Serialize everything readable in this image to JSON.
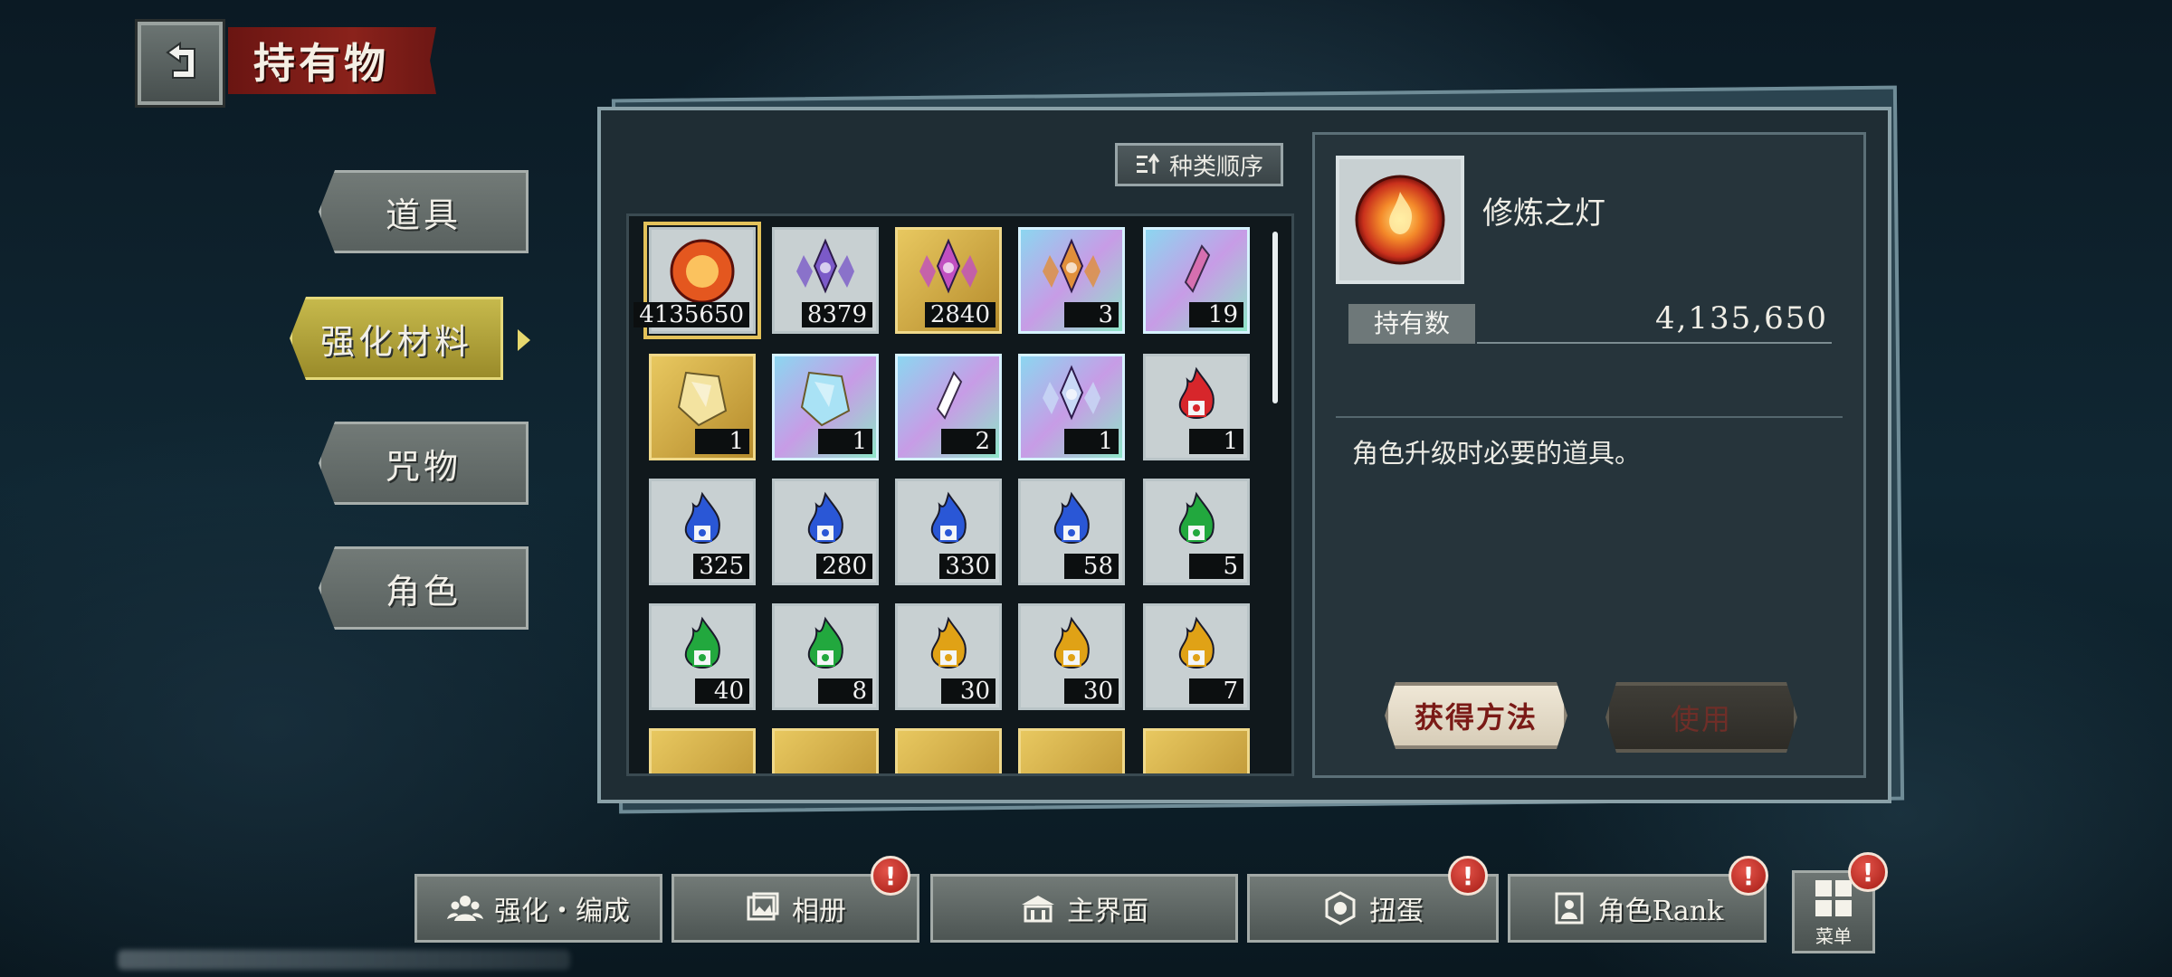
{
  "header": {
    "title": "持有物"
  },
  "tabs": [
    {
      "label": "道具",
      "active": false
    },
    {
      "label": "强化材料",
      "active": true
    },
    {
      "label": "咒物",
      "active": false
    },
    {
      "label": "角色",
      "active": false
    }
  ],
  "sort": {
    "label": "种类顺序"
  },
  "items": [
    {
      "count": "4135650",
      "style": "orb",
      "frame": "silver",
      "color": "#e4571f",
      "selected": true
    },
    {
      "count": "8379",
      "style": "crystal",
      "frame": "silver",
      "color": "#7b5ac8"
    },
    {
      "count": "2840",
      "style": "crystal",
      "frame": "gold",
      "color": "#c04fc0"
    },
    {
      "count": "3",
      "style": "crystal",
      "frame": "rainbow",
      "color": "#e08f3a"
    },
    {
      "count": "19",
      "style": "shard",
      "frame": "rainbow",
      "color": "#d66fb0"
    },
    {
      "count": "1",
      "style": "gem",
      "frame": "gold",
      "color": "#f3e3a0"
    },
    {
      "count": "1",
      "style": "gem",
      "frame": "rainbow",
      "color": "#a9e2f5"
    },
    {
      "count": "2",
      "style": "shard",
      "frame": "rainbow",
      "color": "#ffffff"
    },
    {
      "count": "1",
      "style": "crystal",
      "frame": "rainbow",
      "color": "#c9d9f6"
    },
    {
      "count": "1",
      "style": "flame",
      "frame": "silver",
      "color": "#d7262b"
    },
    {
      "count": "325",
      "style": "flame",
      "frame": "silver",
      "color": "#2a57d6"
    },
    {
      "count": "280",
      "style": "flame",
      "frame": "silver",
      "color": "#2a57d6"
    },
    {
      "count": "330",
      "style": "flame",
      "frame": "silver",
      "color": "#2a57d6"
    },
    {
      "count": "58",
      "style": "flame",
      "frame": "silver",
      "color": "#2a57d6"
    },
    {
      "count": "5",
      "style": "flame",
      "frame": "silver",
      "color": "#22a83e"
    },
    {
      "count": "40",
      "style": "flame",
      "frame": "silver",
      "color": "#22a83e"
    },
    {
      "count": "8",
      "style": "flame",
      "frame": "silver",
      "color": "#22a83e"
    },
    {
      "count": "30",
      "style": "flame",
      "frame": "silver",
      "color": "#e0a216"
    },
    {
      "count": "30",
      "style": "flame",
      "frame": "silver",
      "color": "#e0a216"
    },
    {
      "count": "7",
      "style": "flame",
      "frame": "silver",
      "color": "#e0a216"
    }
  ],
  "partial_row_frames": [
    "gold",
    "gold",
    "gold",
    "gold",
    "gold"
  ],
  "detail": {
    "name": "修炼之灯",
    "owned_label": "持有数",
    "owned_value": "4,135,650",
    "description": "角色升级时必要的道具。",
    "obtain_label": "获得方法",
    "use_label": "使用"
  },
  "nav": [
    {
      "label": "强化・编成",
      "icon": "team-icon",
      "badge": false
    },
    {
      "label": "相册",
      "icon": "album-icon",
      "badge": true
    },
    {
      "label": "主界面",
      "icon": "home-icon",
      "badge": false
    },
    {
      "label": "扭蛋",
      "icon": "gacha-icon",
      "badge": true
    },
    {
      "label": "角色Rank",
      "icon": "rank-icon",
      "badge": true
    }
  ],
  "menu": {
    "label": "菜单",
    "badge": true
  },
  "badge_glyph": "!",
  "colors": {
    "accent_gold": "#c6b94c",
    "title_red": "#8a221b",
    "badge_red": "#c0281f"
  }
}
